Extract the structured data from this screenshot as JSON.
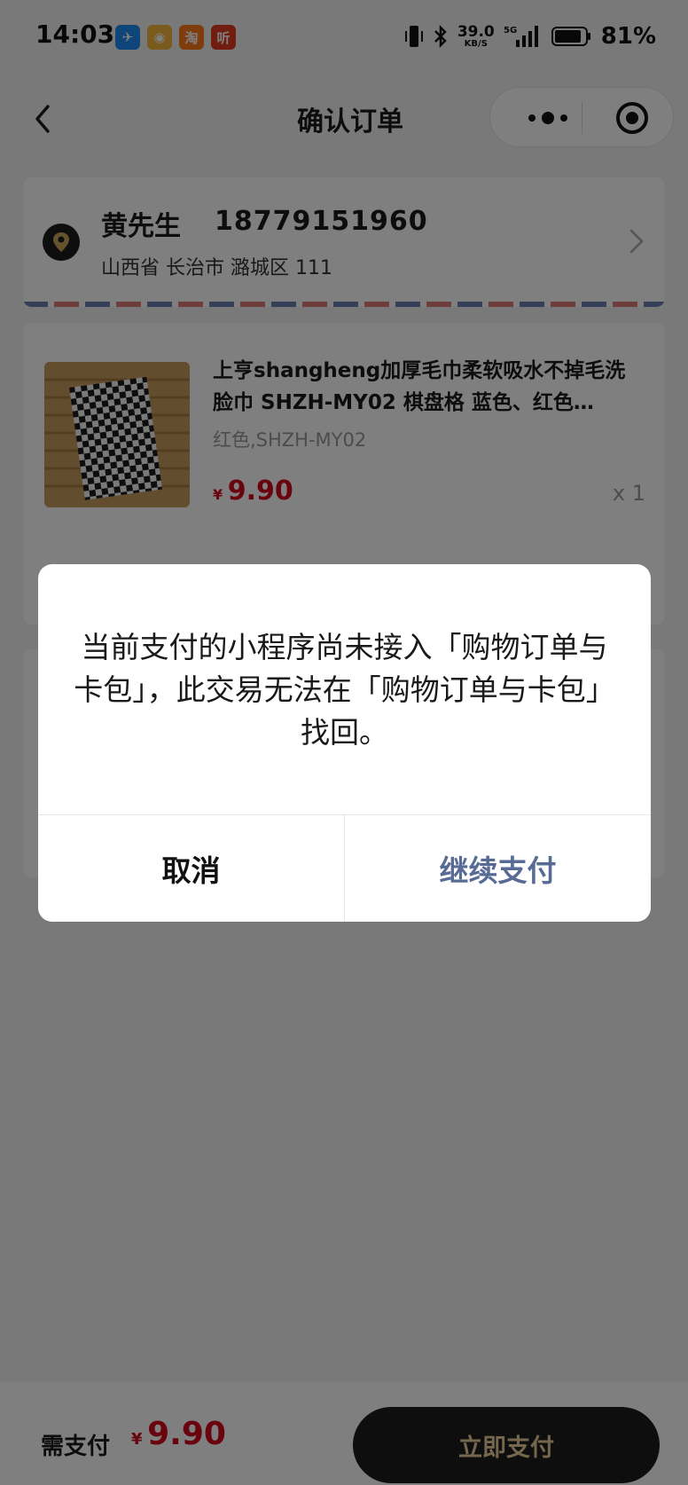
{
  "status_bar": {
    "time": "14:03",
    "apps": [
      {
        "icon": "dingtalk-icon",
        "color": "#1f8cf5",
        "glyph": "✈"
      },
      {
        "icon": "weibo-icon",
        "color": "#f2a51d",
        "glyph": "◉"
      },
      {
        "icon": "taobao-icon",
        "color": "#ff6a00",
        "glyph": "淘"
      },
      {
        "icon": "listen-app-icon",
        "color": "#e23d22",
        "glyph": "听"
      }
    ],
    "net_speed": "39.0",
    "net_unit": "KB/S",
    "network": "5G",
    "battery": "81%"
  },
  "nav": {
    "title": "确认订单"
  },
  "address": {
    "name": "黄先生",
    "phone": "18779151960",
    "detail": "山西省 长治市 潞城区 111"
  },
  "product": {
    "title": "上亨shangheng加厚毛巾柔软吸水不掉毛洗脸巾 SHZH-MY02 棋盘格 蓝色、红色…",
    "spec": "红色,SHZH-MY02",
    "currency": "¥",
    "price": "9.90",
    "quantity": "x 1"
  },
  "footer": {
    "label": "需支付",
    "currency": "¥",
    "total": "9.90",
    "pay_button": "立即支付"
  },
  "dialog": {
    "message": "当前支付的小程序尚未接入「购物订单与卡包」，此交易无法在「购物订单与卡包」找回。",
    "cancel": "取消",
    "confirm": "继续支付"
  },
  "colors": {
    "price_red": "#d2071c",
    "confirm_blue": "#576b95",
    "pay_button_text": "#e9cf9a"
  }
}
